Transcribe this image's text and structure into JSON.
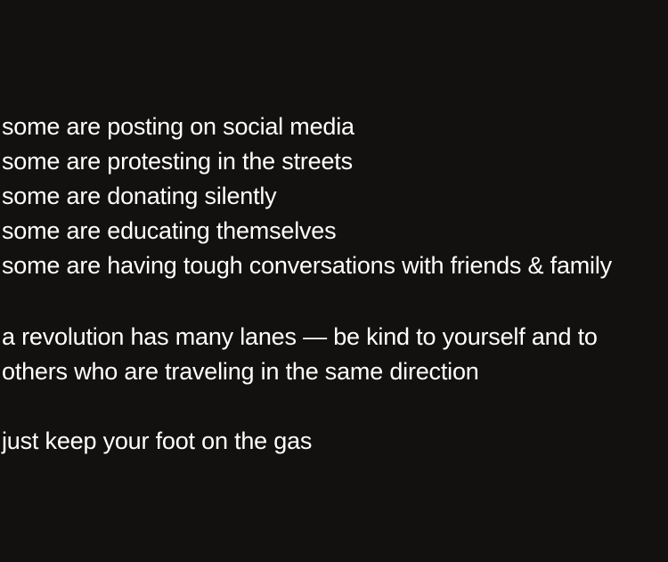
{
  "background_color": "#121110",
  "text_color": "#ffffff",
  "lines": [
    "some are posting on social media",
    "some are protesting in the streets",
    "some are donating silently",
    "some are educating themselves",
    "some are having tough conversations with friends & family",
    "a revolution has many lanes — be kind to yourself and to",
    "others who are traveling in the same direction",
    "just keep your foot on the gas"
  ]
}
